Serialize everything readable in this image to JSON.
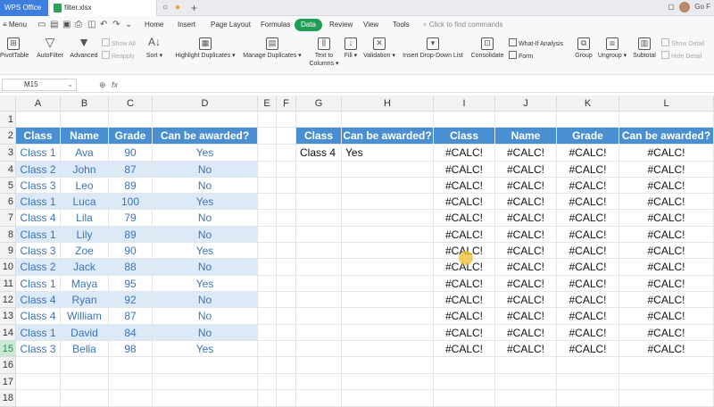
{
  "titlebar": {
    "app_label": "WPS Office",
    "doc_tab": "filter.xlsx",
    "right_text": "Go F"
  },
  "menubar": {
    "menu": "Menu",
    "tabs": [
      "Home",
      "Insert",
      "Page Layout",
      "Formulas",
      "Data",
      "Review",
      "View",
      "Tools"
    ],
    "active_tab": "Data",
    "search_placeholder": "Click to find commands"
  },
  "ribbon": {
    "pivot": "PivotTable",
    "autofilter": "AutoFilter",
    "advanced": "Advanced",
    "show_all": "Show All",
    "reapply": "Reapply",
    "sort": "Sort",
    "highlight_duplicates": "Highlight Duplicates",
    "manage_duplicates": "Manage Duplicates",
    "text_to_columns_1": "Text to",
    "text_to_columns_2": "Columns",
    "fill": "Fill",
    "validation": "Validation",
    "insert_dropdown": "Insert Drop-Down List",
    "consolidate": "Consolidate",
    "what_if": "What-If Analysis",
    "form": "Form",
    "group": "Group",
    "ungroup": "Ungroup",
    "subtotal": "Subtotal",
    "show_detail": "Show Detail",
    "hide_detail": "Hide Detail"
  },
  "formulabar": {
    "name_box": "M15",
    "fx": "fx"
  },
  "columns": [
    "A",
    "B",
    "C",
    "D",
    "E",
    "F",
    "G",
    "H",
    "I",
    "J",
    "K",
    "L"
  ],
  "rows": [
    "1",
    "2",
    "3",
    "4",
    "5",
    "6",
    "7",
    "8",
    "9",
    "10",
    "11",
    "12",
    "13",
    "14",
    "15",
    "16",
    "17",
    "18"
  ],
  "selected_row": "15",
  "left_table": {
    "headers": [
      "Class",
      "Name",
      "Grade",
      "Can be awarded?"
    ],
    "rows": [
      [
        "Class 1",
        "Ava",
        "90",
        "Yes"
      ],
      [
        "Class 2",
        "John",
        "87",
        "No"
      ],
      [
        "Class 3",
        "Leo",
        "89",
        "No"
      ],
      [
        "Class 1",
        "Luca",
        "100",
        "Yes"
      ],
      [
        "Class 4",
        "Lila",
        "79",
        "No"
      ],
      [
        "Class 1",
        "Lily",
        "89",
        "No"
      ],
      [
        "Class 3",
        "Zoe",
        "90",
        "Yes"
      ],
      [
        "Class 2",
        "Jack",
        "88",
        "No"
      ],
      [
        "Class 1",
        "Maya",
        "95",
        "Yes"
      ],
      [
        "Class 4",
        "Ryan",
        "92",
        "No"
      ],
      [
        "Class 4",
        "William",
        "87",
        "No"
      ],
      [
        "Class 1",
        "David",
        "84",
        "No"
      ],
      [
        "Class 3",
        "Bella",
        "98",
        "Yes"
      ]
    ]
  },
  "criteria_table": {
    "headers": [
      "Class",
      "Can be awarded?"
    ],
    "values": [
      "Class 4",
      "Yes"
    ]
  },
  "result_table": {
    "headers": [
      "Class",
      "Name",
      "Grade",
      "Can be awarded?"
    ],
    "error_value": "#CALC!",
    "row_count": 13
  }
}
